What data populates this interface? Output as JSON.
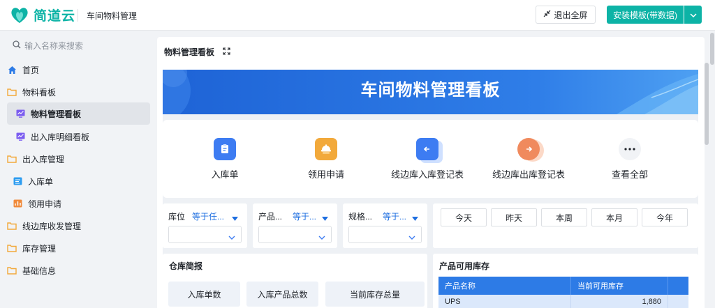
{
  "brand": {
    "name": "简道云",
    "color": "#0db3a6"
  },
  "header": {
    "app_name": "车间物料管理",
    "exit_fullscreen": "退出全屏",
    "install_template": "安装模板(带数据)"
  },
  "sidebar": {
    "search_placeholder": "输入名称来搜索",
    "items": [
      {
        "label": "首页",
        "icon": "home-icon"
      },
      {
        "label": "物料看板",
        "icon": "folder-icon"
      },
      {
        "label": "物料管理看板",
        "icon": "dashboard-icon",
        "active": true
      },
      {
        "label": "出入库明细看板",
        "icon": "dashboard-icon"
      },
      {
        "label": "出入库管理",
        "icon": "folder-icon"
      },
      {
        "label": "入库单",
        "icon": "form-icon"
      },
      {
        "label": "领用申请",
        "icon": "apply-form-icon"
      },
      {
        "label": "线边库收发管理",
        "icon": "folder-icon"
      },
      {
        "label": "库存管理",
        "icon": "folder-icon"
      },
      {
        "label": "基础信息",
        "icon": "folder-icon"
      }
    ]
  },
  "main": {
    "title": "物料管理看板",
    "banner_title": "车间物料管理看板",
    "quick_entries": [
      {
        "label": "入库单",
        "icon": "inbound-form-icon",
        "color": "#3d7cf2"
      },
      {
        "label": "领用申请",
        "icon": "apply-icon",
        "color": "#f2a93b"
      },
      {
        "label": "线边库入库登记表",
        "icon": "line-inbound-icon",
        "color": "#3d7cf2"
      },
      {
        "label": "线边库出库登记表",
        "icon": "line-outbound-icon",
        "color": "#f08a5d"
      },
      {
        "label": "查看全部",
        "icon": "more-icon",
        "color": "#f1f3f6"
      }
    ],
    "filters": [
      {
        "label": "库位",
        "operator": "等于任..."
      },
      {
        "label": "产品...",
        "operator": "等于..."
      },
      {
        "label": "规格...",
        "operator": "等于..."
      }
    ],
    "date_buttons": [
      "今天",
      "昨天",
      "本周",
      "本月",
      "今年"
    ],
    "warehouse_card": {
      "title": "仓库简报",
      "stats": [
        "入库单数",
        "入库产品总数",
        "当前库存总量"
      ]
    },
    "inventory_card": {
      "title": "产品可用库存",
      "columns": [
        "产品名称",
        "当前可用库存"
      ],
      "rows": [
        {
          "name": "UPS",
          "qty": "1,880"
        }
      ]
    }
  }
}
